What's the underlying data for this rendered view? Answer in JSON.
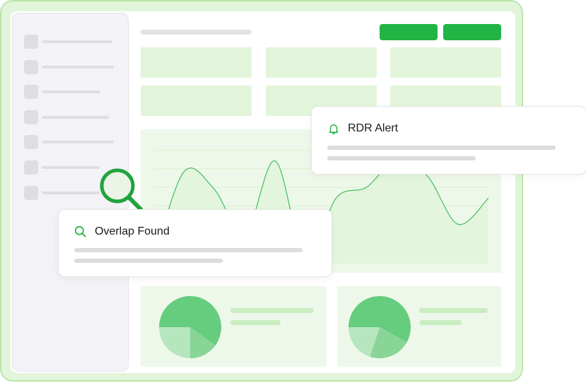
{
  "sidebar": {
    "items": [
      {
        "icon": "placeholder-icon"
      },
      {
        "icon": "placeholder-icon"
      },
      {
        "icon": "placeholder-icon"
      },
      {
        "icon": "placeholder-icon"
      },
      {
        "icon": "placeholder-icon"
      },
      {
        "icon": "placeholder-icon"
      },
      {
        "icon": "placeholder-icon"
      }
    ]
  },
  "header": {
    "buttons": [
      {
        "label": ""
      },
      {
        "label": ""
      }
    ]
  },
  "popups": {
    "alert": {
      "title": "RDR Alert",
      "icon": "bell-icon"
    },
    "overlap": {
      "title": "Overlap Found",
      "icon": "search-icon"
    }
  },
  "magnifier": {
    "icon": "magnifier-icon"
  },
  "colors": {
    "accent": "#22b444",
    "light_green": "#e2f5da",
    "panel_green": "#eef8ea",
    "pie_dark": "#66cc7e",
    "pie_mid": "#88d597",
    "pie_light": "#b6e6bd"
  },
  "chart_data": {
    "type": "line",
    "title": "",
    "xlabel": "",
    "ylabel": "",
    "grid": true,
    "x": [
      0,
      1,
      2,
      3,
      4,
      5,
      6,
      7,
      8,
      9,
      10,
      11
    ],
    "series": [
      {
        "values": [
          1,
          42,
          34,
          13,
          47,
          1,
          30,
          35,
          48,
          40,
          18,
          30
        ]
      }
    ],
    "ylim": [
      0,
      55
    ]
  },
  "pies": [
    {
      "slices": [
        0.6,
        0.15,
        0.25
      ]
    },
    {
      "slices": [
        0.58,
        0.22,
        0.2
      ]
    }
  ]
}
